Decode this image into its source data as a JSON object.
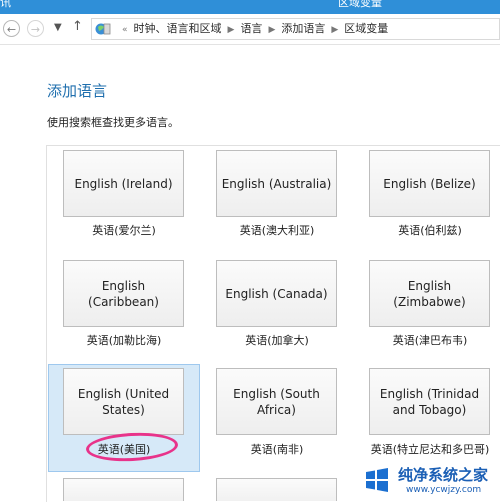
{
  "window": {
    "left_fragment": "讯",
    "title": "区域变量"
  },
  "nav": {
    "back_icon": "back-arrow-icon",
    "forward_icon": "forward-arrow-icon",
    "dropdown_icon": "chevron-down-icon",
    "up_icon": "up-arrow-icon",
    "breadcrumb": [
      "时钟、语言和区域",
      "语言",
      "添加语言",
      "区域变量"
    ]
  },
  "page": {
    "heading": "添加语言",
    "subtext": "使用搜索框查找更多语言。"
  },
  "languages": [
    {
      "name": "English (Ireland)",
      "caption": "英语(爱尔兰)"
    },
    {
      "name": "English (Australia)",
      "caption": "英语(澳大利亚)"
    },
    {
      "name": "English (Belize)",
      "caption": "英语(伯利兹)"
    },
    {
      "name": "English (Caribbean)",
      "caption": "英语(加勒比海)"
    },
    {
      "name": "English (Canada)",
      "caption": "英语(加拿大)"
    },
    {
      "name": "English (Zimbabwe)",
      "caption": "英语(津巴布韦)"
    },
    {
      "name": "English (United States)",
      "caption": "英语(美国)",
      "selected": true
    },
    {
      "name": "English (South Africa)",
      "caption": "英语(南非)"
    },
    {
      "name": "English (Trinidad and Tobago)",
      "caption": "英语(特立尼达和多巴哥)"
    }
  ],
  "annotation": {
    "color": "#e8338a"
  },
  "colors": {
    "accent": "#1f6fae",
    "selection": "#d6e9f8",
    "titlebar": "#2f8fd8"
  },
  "watermark": {
    "title": "纯净系统之家",
    "url": "www.ycwjzy.com"
  }
}
